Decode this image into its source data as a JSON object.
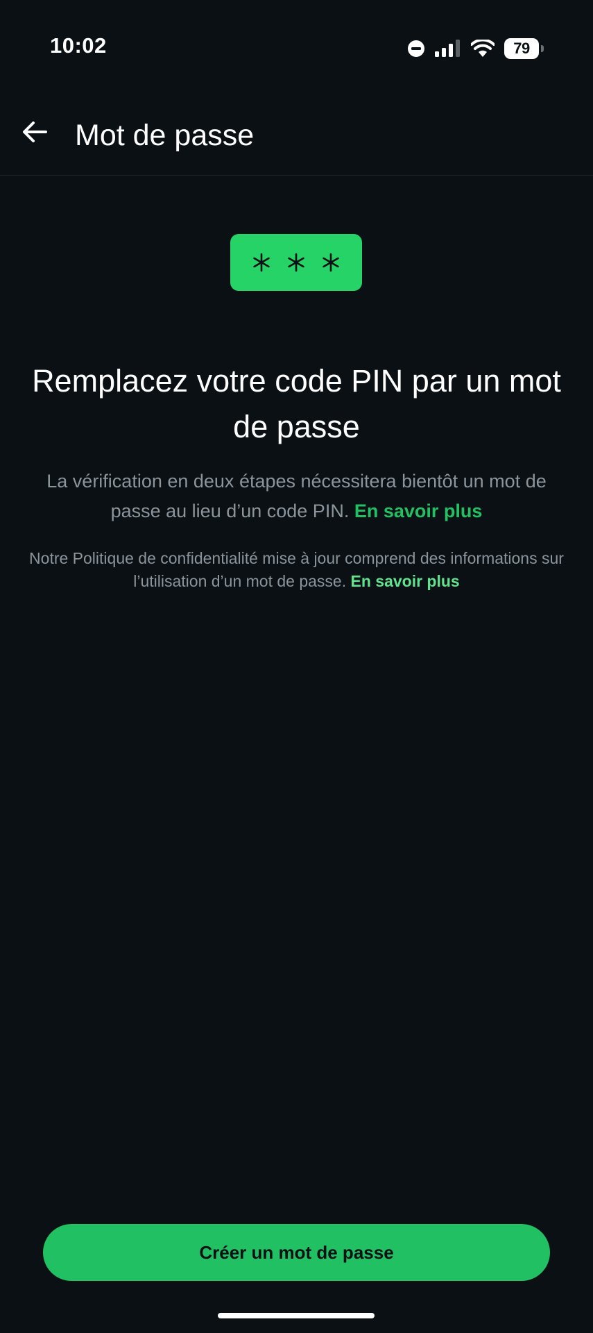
{
  "status_bar": {
    "time": "10:02",
    "battery_level": "79",
    "icons": [
      "do-not-disturb-icon",
      "signal-icon",
      "wifi-icon",
      "battery-icon"
    ]
  },
  "app_bar": {
    "title": "Mot de passe",
    "back_icon": "arrow-left-icon"
  },
  "pin_badge": {
    "symbols": [
      "*",
      "*",
      "*"
    ],
    "color": "#25d366"
  },
  "main": {
    "headline": "Remplacez votre code PIN par un mot de passe",
    "description": "La vérification en deux étapes nécessitera bientôt un mot de passe au lieu d’un code PIN.",
    "description_link": "En savoir plus",
    "policy": "Notre Politique de confidentialité mise à jour comprend des informations sur l’utilisation d’un mot de passe.",
    "policy_link": "En savoir plus"
  },
  "cta": {
    "label": "Créer un mot de passe",
    "color": "#21c063"
  },
  "colors": {
    "background": "#0b1014",
    "accent": "#21c063",
    "text_primary": "#ffffff",
    "text_secondary": "#8b959b"
  }
}
